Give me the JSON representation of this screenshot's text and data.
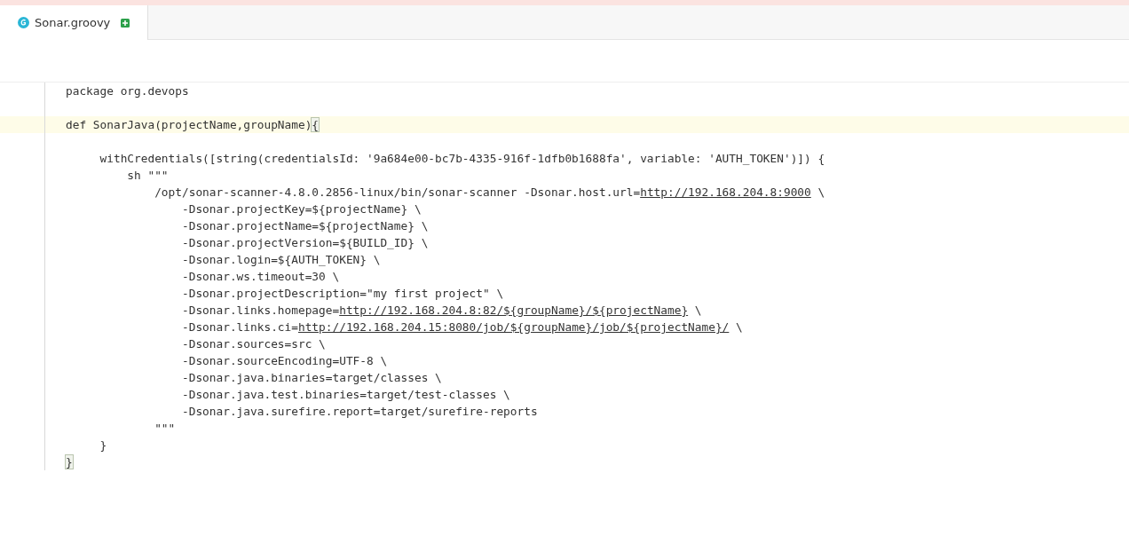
{
  "tabs": [
    {
      "label": "Sonar.groovy",
      "selected": true
    }
  ],
  "code_lines": [
    {
      "current": false,
      "segments": [
        {
          "kind": "plain",
          "text": "package org.devops"
        }
      ]
    },
    {
      "current": false
    },
    {
      "current": true,
      "segments": [
        {
          "kind": "plain",
          "text": "def SonarJava(projectName,groupName)"
        },
        {
          "kind": "bracket",
          "text": "{"
        }
      ]
    },
    {
      "current": false
    },
    {
      "current": false,
      "segments": [
        {
          "kind": "plain",
          "text": "     withCredentials([string(credentialsId: '9a684e00-bc7b-4335-916f-1dfb0b1688fa', variable: 'AUTH_TOKEN')]) {"
        }
      ]
    },
    {
      "current": false,
      "segments": [
        {
          "kind": "plain",
          "text": "         sh \"\"\""
        }
      ]
    },
    {
      "current": false,
      "segments": [
        {
          "kind": "plain",
          "text": "             /opt/sonar-scanner-4.8.0.2856-linux/bin/sonar-scanner -Dsonar.host.url="
        },
        {
          "kind": "link",
          "text": "http://192.168.204.8:9000"
        },
        {
          "kind": "plain",
          "text": " \\"
        }
      ]
    },
    {
      "current": false,
      "segments": [
        {
          "kind": "plain",
          "text": "                 -Dsonar.projectKey=${projectName} \\"
        }
      ]
    },
    {
      "current": false,
      "segments": [
        {
          "kind": "plain",
          "text": "                 -Dsonar.projectName=${projectName} \\"
        }
      ]
    },
    {
      "current": false,
      "segments": [
        {
          "kind": "plain",
          "text": "                 -Dsonar.projectVersion=${BUILD_ID} \\"
        }
      ]
    },
    {
      "current": false,
      "segments": [
        {
          "kind": "plain",
          "text": "                 -Dsonar.login=${AUTH_TOKEN} \\"
        }
      ]
    },
    {
      "current": false,
      "segments": [
        {
          "kind": "plain",
          "text": "                 -Dsonar.ws.timeout=30 \\"
        }
      ]
    },
    {
      "current": false,
      "segments": [
        {
          "kind": "plain",
          "text": "                 -Dsonar.projectDescription=\"my first project\" \\"
        }
      ]
    },
    {
      "current": false,
      "segments": [
        {
          "kind": "plain",
          "text": "                 -Dsonar.links.homepage="
        },
        {
          "kind": "link",
          "text": "http://192.168.204.8:82/${groupName}/${projectName}"
        },
        {
          "kind": "plain",
          "text": " \\"
        }
      ]
    },
    {
      "current": false,
      "segments": [
        {
          "kind": "plain",
          "text": "                 -Dsonar.links.ci="
        },
        {
          "kind": "link",
          "text": "http://192.168.204.15:8080/job/${groupName}/job/${projectName}/"
        },
        {
          "kind": "plain",
          "text": " \\"
        }
      ]
    },
    {
      "current": false,
      "segments": [
        {
          "kind": "plain",
          "text": "                 -Dsonar.sources=src \\"
        }
      ]
    },
    {
      "current": false,
      "segments": [
        {
          "kind": "plain",
          "text": "                 -Dsonar.sourceEncoding=UTF-8 \\"
        }
      ]
    },
    {
      "current": false,
      "segments": [
        {
          "kind": "plain",
          "text": "                 -Dsonar.java.binaries=target/classes \\"
        }
      ]
    },
    {
      "current": false,
      "segments": [
        {
          "kind": "plain",
          "text": "                 -Dsonar.java.test.binaries=target/test-classes \\"
        }
      ]
    },
    {
      "current": false,
      "segments": [
        {
          "kind": "plain",
          "text": "                 -Dsonar.java.surefire.report=target/surefire-reports"
        }
      ]
    },
    {
      "current": false,
      "segments": [
        {
          "kind": "plain",
          "text": "             \"\"\""
        }
      ]
    },
    {
      "current": false,
      "segments": [
        {
          "kind": "plain",
          "text": "     }"
        }
      ]
    },
    {
      "current": false,
      "segments": [
        {
          "kind": "bracket",
          "text": "}"
        }
      ]
    }
  ]
}
